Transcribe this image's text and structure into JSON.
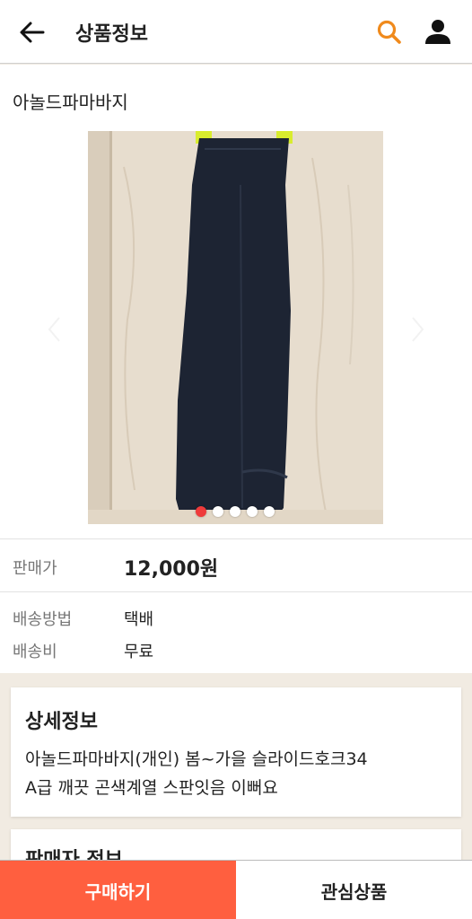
{
  "header": {
    "title": "상품정보",
    "back_icon": "arrow-left-icon",
    "search_icon": "search-icon",
    "user_icon": "user-icon",
    "search_color": "#f08a1c"
  },
  "product": {
    "name": "아놀드파마바지",
    "image_count": 5,
    "active_image": 1,
    "price_label": "판매가",
    "price_value": "12,000원",
    "shipping_method_label": "배송방법",
    "shipping_method_value": "택배",
    "shipping_fee_label": "배송비",
    "shipping_fee_value": "무료"
  },
  "detail": {
    "title": "상세정보",
    "line1": "아놀드파마바지(개인) 봄~가을 슬라이드호크34",
    "line2": "A급 깨끗 곤색계열 스판잇음 이뻐요"
  },
  "seller": {
    "title": "판매자 정보"
  },
  "bottom": {
    "buy_label": "구매하기",
    "wishlist_label": "관심상품",
    "buy_color": "#ff5f3f"
  }
}
